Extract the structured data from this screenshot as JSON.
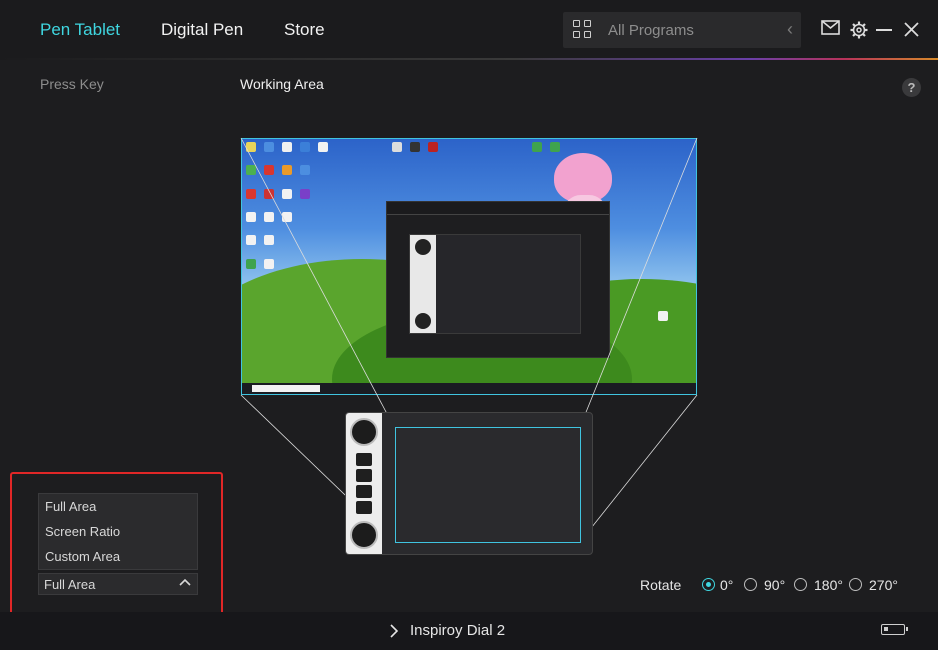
{
  "nav": {
    "tabs": [
      {
        "label": "Pen Tablet",
        "active": true
      },
      {
        "label": "Digital Pen",
        "active": false
      },
      {
        "label": "Store",
        "active": false
      }
    ],
    "programs_label": "All Programs",
    "accent_color": "#3fd6e0"
  },
  "subheader": {
    "press_key": "Press Key",
    "working_area": "Working Area",
    "help": "?"
  },
  "area_menu": {
    "options": [
      "Full Area",
      "Screen Ratio",
      "Custom Area"
    ],
    "selected": "Full Area",
    "highlight_color": "#e12727"
  },
  "rotate": {
    "label": "Rotate",
    "options": [
      "0°",
      "90°",
      "180°",
      "270°"
    ],
    "selected": "0°"
  },
  "device": {
    "name": "Inspiroy Dial 2"
  }
}
